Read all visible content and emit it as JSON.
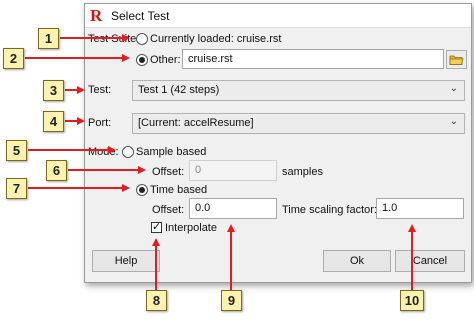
{
  "window": {
    "title": "Select Test",
    "app_icon": "R"
  },
  "test_suite": {
    "label": "Test Suite:",
    "currently_loaded_label": "Currently loaded: cruise.rst",
    "other_label": "Other:",
    "other_value": "cruise.rst",
    "selected": "other"
  },
  "test": {
    "label": "Test:",
    "value": "Test 1 (42 steps)"
  },
  "port": {
    "label": "Port:",
    "value": "[Current: accelResume]"
  },
  "mode": {
    "label": "Mode:",
    "sample_based_label": "Sample based",
    "sample_offset_label": "Offset:",
    "sample_offset_value": "0",
    "samples_unit": "samples",
    "time_based_label": "Time based",
    "time_offset_label": "Offset:",
    "time_offset_value": "0.0",
    "scaling_label": "Time scaling factor:",
    "scaling_value": "1.0",
    "interpolate_label": "Interpolate",
    "interpolate_checked": true,
    "selected": "time"
  },
  "buttons": {
    "help": "Help",
    "ok": "Ok",
    "cancel": "Cancel"
  },
  "callouts": [
    "1",
    "2",
    "3",
    "4",
    "5",
    "6",
    "7",
    "8",
    "9",
    "10"
  ],
  "colors": {
    "arrow": "#e21d1d",
    "callout_fill": "#fdf3b0",
    "app_icon": "#d41414"
  }
}
